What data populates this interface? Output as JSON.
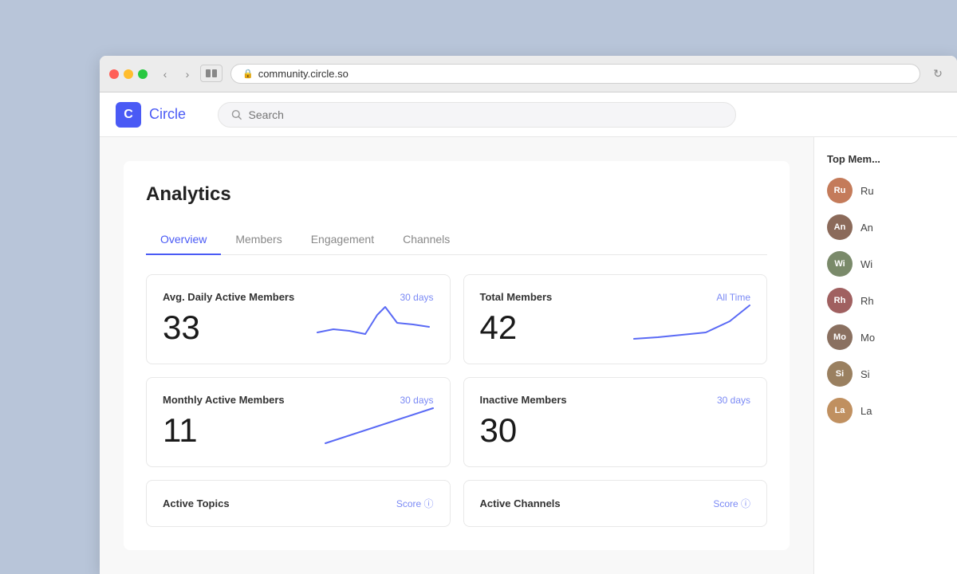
{
  "browser": {
    "url": "community.circle.so"
  },
  "nav": {
    "brand_letter": "C",
    "brand_name": "Circle",
    "search_placeholder": "Search"
  },
  "analytics": {
    "title": "Analytics",
    "tabs": [
      {
        "id": "overview",
        "label": "Overview",
        "active": true
      },
      {
        "id": "members",
        "label": "Members",
        "active": false
      },
      {
        "id": "engagement",
        "label": "Engagement",
        "active": false
      },
      {
        "id": "channels",
        "label": "Channels",
        "active": false
      }
    ],
    "stats": [
      {
        "id": "avg-daily-active",
        "label": "Avg. Daily Active Members",
        "value": "33",
        "period": "30 days",
        "chart_type": "line_spiky"
      },
      {
        "id": "total-members",
        "label": "Total Members",
        "value": "42",
        "period": "All Time",
        "chart_type": "line_rising"
      },
      {
        "id": "monthly-active",
        "label": "Monthly Active Members",
        "value": "11",
        "period": "30 days",
        "chart_type": "line_diagonal"
      },
      {
        "id": "inactive-members",
        "label": "Inactive Members",
        "value": "30",
        "period": "30 days",
        "chart_type": "none"
      }
    ],
    "bottom_cards": [
      {
        "id": "active-topics",
        "label": "Active Topics",
        "period_label": "Score",
        "has_info": true
      },
      {
        "id": "active-channels",
        "label": "Active Channels",
        "period_label": "Score",
        "has_info": true
      }
    ]
  },
  "top_members": {
    "title": "Top Mem...",
    "members": [
      {
        "id": "m1",
        "initials": "Ru",
        "color": "av1"
      },
      {
        "id": "m2",
        "initials": "An",
        "color": "av2"
      },
      {
        "id": "m3",
        "initials": "Wi",
        "color": "av3"
      },
      {
        "id": "m4",
        "initials": "Rh",
        "color": "av4"
      },
      {
        "id": "m5",
        "initials": "Mo",
        "color": "av5"
      },
      {
        "id": "m6",
        "initials": "Si",
        "color": "av6"
      },
      {
        "id": "m7",
        "initials": "La",
        "color": "av7"
      }
    ]
  }
}
